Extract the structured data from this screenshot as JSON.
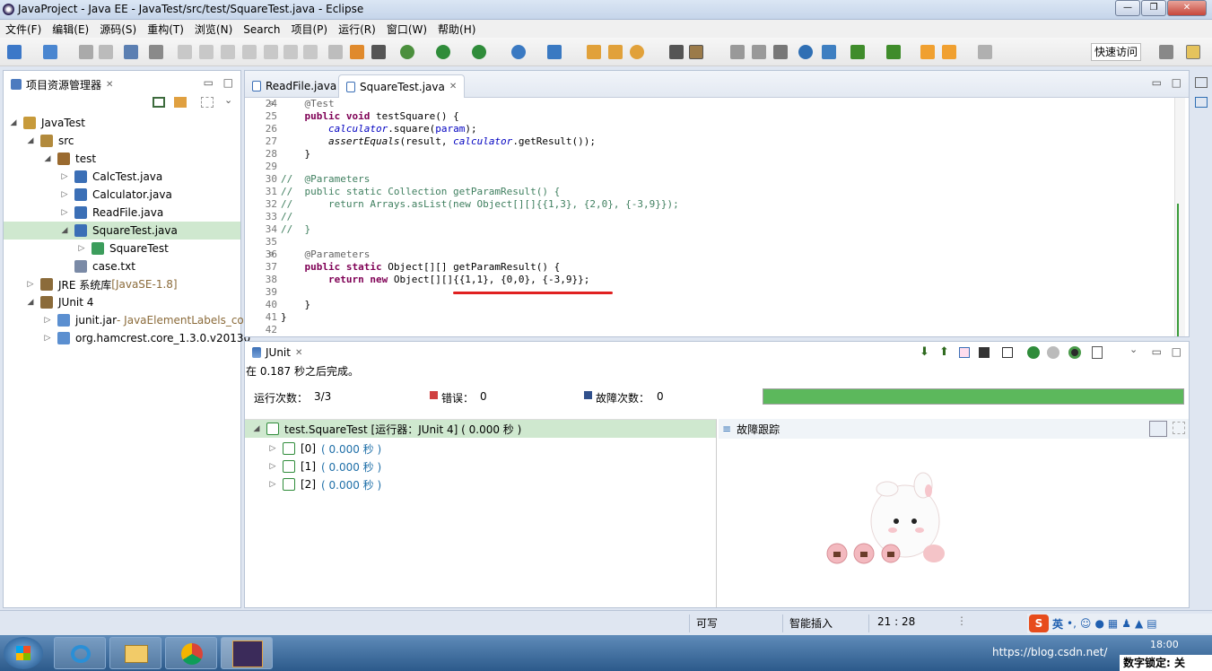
{
  "window": {
    "title": "JavaProject - Java EE - JavaTest/src/test/SquareTest.java - Eclipse",
    "controls": [
      "—",
      "❐",
      "✕"
    ]
  },
  "menu": [
    "文件(F)",
    "编辑(E)",
    "源码(S)",
    "重构(T)",
    "浏览(N)",
    "Search",
    "项目(P)",
    "运行(R)",
    "窗口(W)",
    "帮助(H)"
  ],
  "quick_access": "快速访问",
  "explorer": {
    "title": "项目资源管理器",
    "tree": [
      {
        "label": "JavaTest",
        "indent": 0,
        "arrow": "◢",
        "icon": "project-folder-icon",
        "color": "#c79a3a"
      },
      {
        "label": "src",
        "indent": 1,
        "arrow": "◢",
        "icon": "source-folder-icon",
        "color": "#b28a3c"
      },
      {
        "label": "test",
        "indent": 2,
        "arrow": "◢",
        "icon": "package-icon",
        "color": "#9a6a2f"
      },
      {
        "label": "CalcTest.java",
        "indent": 3,
        "arrow": "▷",
        "icon": "java-file-icon",
        "color": "#3b6fb6"
      },
      {
        "label": "Calculator.java",
        "indent": 3,
        "arrow": "▷",
        "icon": "java-file-icon",
        "color": "#3b6fb6"
      },
      {
        "label": "ReadFile.java",
        "indent": 3,
        "arrow": "▷",
        "icon": "java-file-icon",
        "color": "#3b6fb6"
      },
      {
        "label": "SquareTest.java",
        "indent": 3,
        "arrow": "◢",
        "icon": "java-file-icon",
        "color": "#3b6fb6",
        "selected": true
      },
      {
        "label": "SquareTest",
        "indent": 4,
        "arrow": "▷",
        "icon": "class-icon",
        "color": "#3c9d5c"
      },
      {
        "label": "case.txt",
        "indent": 3,
        "arrow": "",
        "icon": "text-file-icon",
        "color": "#7a8aa6"
      },
      {
        "label": "JRE 系统库",
        "suffix": " [JavaSE-1.8]",
        "indent": 1,
        "arrow": "▷",
        "icon": "library-icon",
        "color": "#8b6b3a"
      },
      {
        "label": "JUnit 4",
        "indent": 1,
        "arrow": "◢",
        "icon": "library-icon",
        "color": "#8b6b3a"
      },
      {
        "label": "junit.jar",
        "suffix": " - JavaElementLabels_con",
        "indent": 2,
        "arrow": "▷",
        "icon": "jar-icon",
        "color": "#5b8fd0"
      },
      {
        "label": "org.hamcrest.core_1.3.0.v20130",
        "indent": 2,
        "arrow": "▷",
        "icon": "jar-icon",
        "color": "#5b8fd0"
      }
    ]
  },
  "editor": {
    "tabs": [
      {
        "label": "ReadFile.java",
        "active": false
      },
      {
        "label": "SquareTest.java",
        "active": true,
        "close": "✕"
      }
    ],
    "lines": [
      {
        "n": "24",
        "fold": "⊖",
        "html": "    <span class='an'>@Test</span>"
      },
      {
        "n": "25",
        "html": "    <span class='kw'>public void</span> testSquare() {"
      },
      {
        "n": "26",
        "html": "        <span class='it'>calculator</span>.square(<span class='it' style='font-style:normal;color:#0000c0'>param</span>);"
      },
      {
        "n": "27",
        "html": "        <i>assertEquals</i>(result, <span class='it'>calculator</span>.getResult());"
      },
      {
        "n": "28",
        "html": "    }"
      },
      {
        "n": "29",
        "html": ""
      },
      {
        "n": "30",
        "html": "<span class='cm'>//  @Parameters</span>"
      },
      {
        "n": "31",
        "html": "<span class='cm'>//  public static Collection getParamResult() {</span>"
      },
      {
        "n": "32",
        "html": "<span class='cm'>//      return Arrays.asList(new Object[][]{{1,3}, {2,0}, {-3,9}});</span>"
      },
      {
        "n": "33",
        "html": "<span class='cm'>//</span>"
      },
      {
        "n": "34",
        "html": "<span class='cm'>//  }</span>"
      },
      {
        "n": "35",
        "html": ""
      },
      {
        "n": "36",
        "fold": "⊖",
        "html": "    <span class='an'>@Parameters</span>"
      },
      {
        "n": "37",
        "html": "    <span class='kw'>public static</span> Object[][] getParamResult() {"
      },
      {
        "n": "38",
        "html": "        <span class='kw'>return new</span> Object[][]{{1,1}, {0,0}, {-3,9}};"
      },
      {
        "n": "39",
        "html": ""
      },
      {
        "n": "40",
        "html": "    }"
      },
      {
        "n": "41",
        "html": "}"
      },
      {
        "n": "42",
        "html": ""
      }
    ]
  },
  "junit": {
    "tab": "JUnit",
    "finished": "在 0.187 秒之后完成。",
    "runs_label": "运行次数：",
    "runs": "3/3",
    "errors_label": "错误：",
    "errors": "0",
    "failures_label": "故障次数：",
    "failures": "0",
    "progress": 1.0,
    "progress_color": "#5cb85c",
    "root": "test.SquareTest [运行器：JUnit 4] ( 0.000 秒 )",
    "items": [
      {
        "idx": "[0]",
        "time": "( 0.000 秒 )"
      },
      {
        "idx": "[1]",
        "time": "( 0.000 秒 )"
      },
      {
        "idx": "[2]",
        "time": "( 0.000 秒 )"
      }
    ],
    "trace_title": "故障跟踪"
  },
  "status": {
    "writable": "可写",
    "insert": "智能插入",
    "position": "21 : 28"
  },
  "ime": {
    "mode": "英"
  },
  "tray": {
    "time": "18:00"
  },
  "watermark": "https://blog.csdn.net/",
  "numlock": "数字锁定: 关"
}
